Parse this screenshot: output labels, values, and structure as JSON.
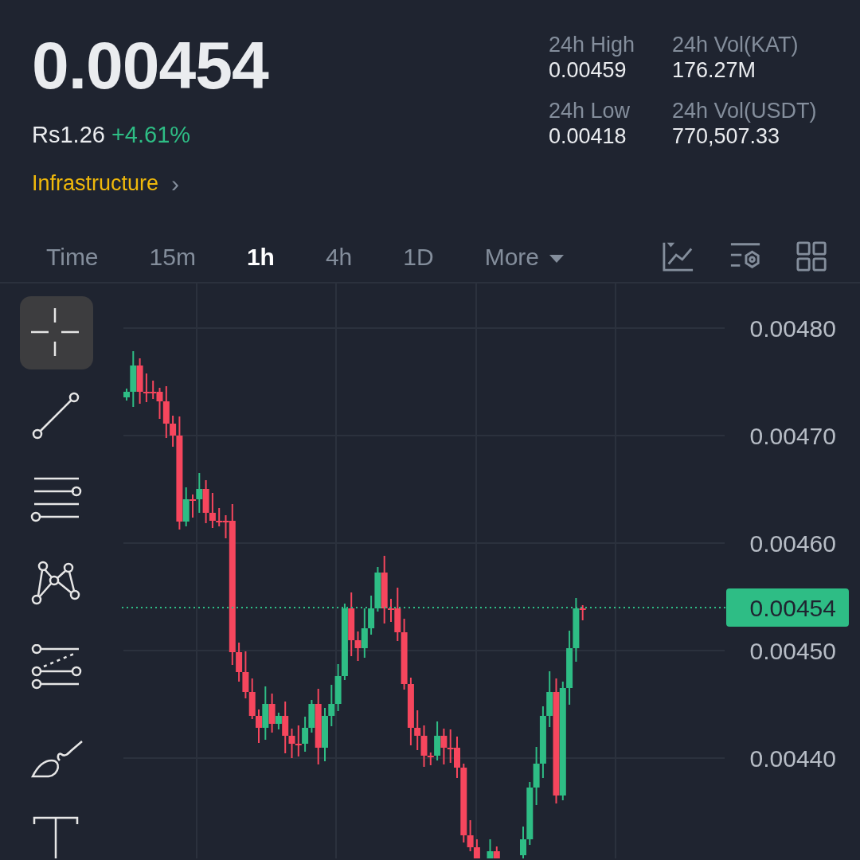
{
  "ticker": {
    "price": "0.00454",
    "fiat_price": "Rs1.26",
    "change": "+4.61%",
    "category": "Infrastructure",
    "category_arrow": "›"
  },
  "stats": [
    {
      "label": "24h High",
      "value": "0.00459"
    },
    {
      "label": "24h Vol(KAT)",
      "value": "176.27M"
    },
    {
      "label": "24h Low",
      "value": "0.00418"
    },
    {
      "label": "24h Vol(USDT)",
      "value": "770,507.33"
    }
  ],
  "intervals": [
    {
      "label": "Time",
      "selected": false
    },
    {
      "label": "15m",
      "selected": false
    },
    {
      "label": "1h",
      "selected": true
    },
    {
      "label": "4h",
      "selected": false
    },
    {
      "label": "1D",
      "selected": false
    },
    {
      "label": "More",
      "selected": false,
      "kind": "dropdown"
    }
  ],
  "tools": [
    {
      "kind": "crosshair",
      "selected": true
    },
    {
      "kind": "trend-line",
      "selected": false
    },
    {
      "kind": "parallel-lines",
      "selected": false
    },
    {
      "kind": "pattern",
      "selected": false
    },
    {
      "kind": "fib",
      "selected": false
    },
    {
      "kind": "brush",
      "selected": false
    },
    {
      "kind": "text",
      "selected": false
    }
  ],
  "chart": {
    "y_axis": [
      "0.00480",
      "0.00470",
      "0.00460",
      "0.00450",
      "0.00440"
    ],
    "last_price": "0.00454"
  }
}
